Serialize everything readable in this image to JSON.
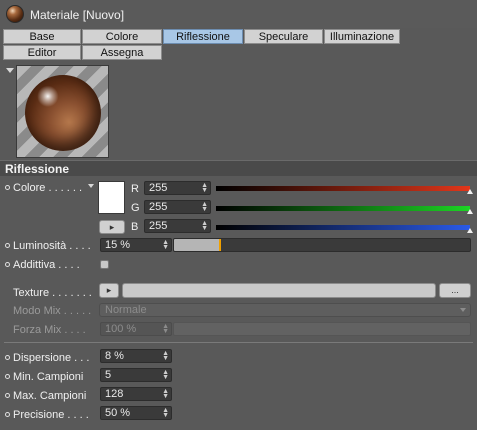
{
  "window": {
    "title": "Materiale [Nuovo]"
  },
  "tabs": [
    {
      "label": "Base",
      "active": false
    },
    {
      "label": "Colore",
      "active": false
    },
    {
      "label": "Riflessione",
      "active": true
    },
    {
      "label": "Speculare",
      "active": false
    },
    {
      "label": "Illuminazione",
      "active": false
    },
    {
      "label": "Editor",
      "active": false
    },
    {
      "label": "Assegna",
      "active": false
    }
  ],
  "section": {
    "title": "Riflessione"
  },
  "color": {
    "label": "Colore . . . . . .",
    "swatch_color": "#ffffff",
    "r_label": "R",
    "r_value": "255",
    "g_label": "G",
    "g_value": "255",
    "b_label": "B",
    "b_value": "255",
    "r_level": 1.0,
    "g_level": 1.0,
    "b_level": 1.0
  },
  "brightness": {
    "label": "Luminosità . . . .",
    "value": "15 %",
    "level": 0.15
  },
  "additive": {
    "label": "Addittiva . . . .",
    "checked": false
  },
  "texture": {
    "label": "Texture . . . . . . .",
    "browse_label": "..."
  },
  "mix_mode": {
    "label": "Modo Mix . . . . .",
    "value": "Normale"
  },
  "mix_strength": {
    "label": "Forza Mix . . . .",
    "value": "100 %"
  },
  "dispersion": {
    "label": "Dispersione . . .",
    "value": "8 %"
  },
  "min_samples": {
    "label": "Min. Campioni",
    "value": "5"
  },
  "max_samples": {
    "label": "Max. Campioni",
    "value": "128"
  },
  "precision": {
    "label": "Precisione . . . .",
    "value": "50 %"
  },
  "colors": {
    "active_tab": "#a8c7e6",
    "lum_marker": "#f0a000"
  }
}
